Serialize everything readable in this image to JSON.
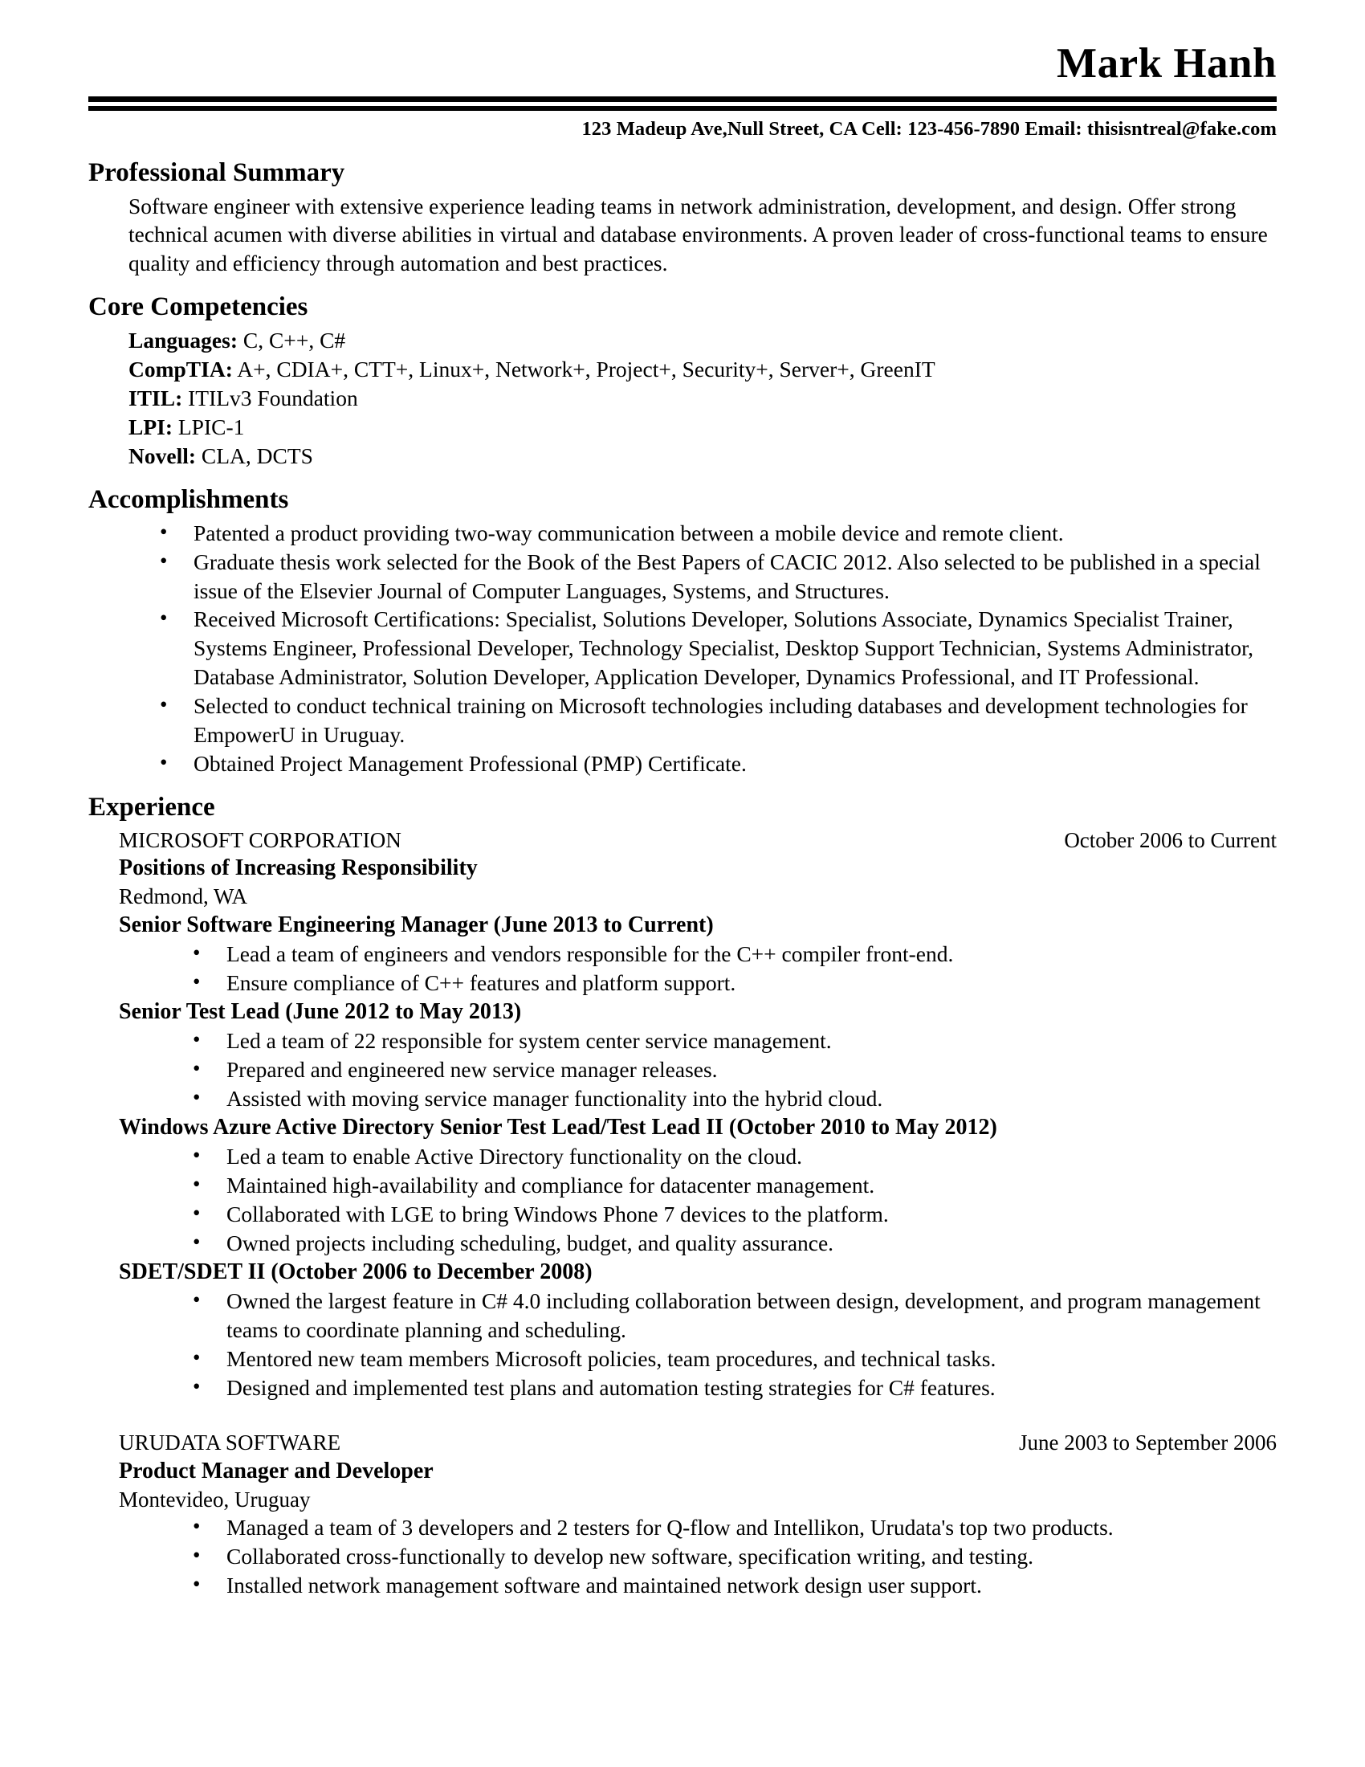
{
  "header": {
    "name": "Mark Hanh",
    "contact": "123 Madeup Ave,Null Street, CA Cell: 123-456-7890 Email: thisisntreal@fake.com"
  },
  "sections": {
    "summary": {
      "title": "Professional Summary",
      "text": "Software engineer with extensive experience leading teams in network administration, development, and design. Offer strong technical acumen with diverse abilities in virtual and database environments. A proven leader of cross-functional teams to ensure quality and efficiency through automation and best practices."
    },
    "competencies": {
      "title": "Core Competencies",
      "items": [
        {
          "label": "Languages:",
          "value": " C, C++, C#"
        },
        {
          "label": "CompTIA:",
          "value": " A+, CDIA+, CTT+, Linux+, Network+, Project+, Security+, Server+, GreenIT"
        },
        {
          "label": "ITIL:",
          "value": " ITILv3 Foundation"
        },
        {
          "label": "LPI:",
          "value": " LPIC-1"
        },
        {
          "label": "Novell:",
          "value": " CLA, DCTS"
        }
      ]
    },
    "accomplishments": {
      "title": "Accomplishments",
      "items": [
        "Patented a product providing two-way communication between a mobile device and remote client.",
        "Graduate thesis work selected for the Book of the Best Papers of CACIC 2012. Also selected to be published in a special issue of the Elsevier Journal of Computer Languages, Systems, and Structures.",
        "Received Microsoft Certifications: Specialist, Solutions Developer, Solutions Associate, Dynamics Specialist Trainer, Systems Engineer, Professional Developer, Technology Specialist, Desktop Support Technician, Systems Administrator, Database Administrator, Solution Developer, Application Developer, Dynamics Professional, and IT Professional.",
        "Selected to conduct technical training on Microsoft technologies including databases and development technologies for EmpowerU in Uruguay.",
        "Obtained Project Management Professional (PMP) Certificate."
      ]
    },
    "experience": {
      "title": "Experience",
      "jobs": [
        {
          "company": "MICROSOFT CORPORATION",
          "dates": "October 2006 to Current",
          "title": "Positions of Increasing Responsibility",
          "location": "Redmond, WA",
          "roles": [
            {
              "name": "Senior Software Engineering Manager (June 2013 to Current)",
              "bullets": [
                "Lead a team of engineers and vendors responsible for the C++ compiler front-end.",
                "Ensure compliance of C++ features and platform support."
              ]
            },
            {
              "name": "Senior Test Lead (June 2012 to May 2013)",
              "bullets": [
                "Led a team of 22 responsible for system center service management.",
                "Prepared and engineered new service manager releases.",
                "Assisted with moving service manager functionality into the hybrid cloud."
              ]
            },
            {
              "name": "Windows Azure Active Directory Senior Test Lead/Test Lead II (October 2010 to May 2012)",
              "bullets": [
                "Led a team to enable Active Directory functionality on the cloud.",
                "Maintained high-availability and compliance for datacenter management.",
                "Collaborated with LGE to bring Windows Phone 7 devices to the platform.",
                "Owned projects including scheduling, budget, and quality assurance."
              ]
            },
            {
              "name": "SDET/SDET II (October 2006 to December 2008)",
              "bullets": [
                "Owned the largest feature in C# 4.0 including collaboration between design, development, and program management teams to coordinate planning and scheduling.",
                "Mentored new team members Microsoft policies, team procedures, and technical tasks.",
                "Designed and implemented test plans and automation testing strategies for C# features."
              ]
            }
          ]
        },
        {
          "company": "URUDATA SOFTWARE",
          "dates": "June 2003 to September 2006",
          "title": "Product Manager and Developer",
          "location": "Montevideo, Uruguay",
          "roles": [
            {
              "name": "",
              "bullets": [
                "Managed a team of 3 developers and 2 testers for Q-flow and Intellikon, Urudata's top two products.",
                "Collaborated cross-functionally to develop new software, specification writing, and testing.",
                "Installed network management software and maintained network design user support."
              ]
            }
          ]
        }
      ]
    }
  }
}
